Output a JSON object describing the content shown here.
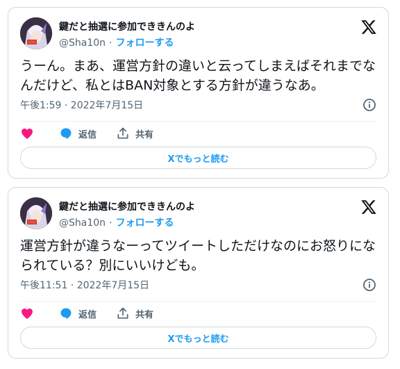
{
  "colors": {
    "accent": "#1d9bf0",
    "like": "#f91880",
    "secondary_text": "#536471",
    "border": "#cfd9de"
  },
  "tweets": [
    {
      "display_name": "鍵だと抽選に参加でききんのよ",
      "handle": "@Sha10n",
      "separator": "·",
      "follow_label": "フォローする",
      "text": "うーん。まあ、運営方針の違いと云ってしまえばそれまでなんだけど、私とはBAN対象とする方針が違うなあ。",
      "timestamp": "午後1:59 · 2022年7月15日",
      "reply_label": "返信",
      "share_label": "共有",
      "read_more_label": "Xでもっと読む",
      "icons": [
        "x-logo-icon",
        "info-icon",
        "heart-icon",
        "reply-icon",
        "share-icon"
      ]
    },
    {
      "display_name": "鍵だと抽選に参加でききんのよ",
      "handle": "@Sha10n",
      "separator": "·",
      "follow_label": "フォローする",
      "text": "運営方針が違うなーってツイートしただけなのにお怒りになられている？別にいいけども。",
      "timestamp": "午後11:51 · 2022年7月15日",
      "reply_label": "返信",
      "share_label": "共有",
      "read_more_label": "Xでもっと読む",
      "icons": [
        "x-logo-icon",
        "info-icon",
        "heart-icon",
        "reply-icon",
        "share-icon"
      ]
    }
  ]
}
